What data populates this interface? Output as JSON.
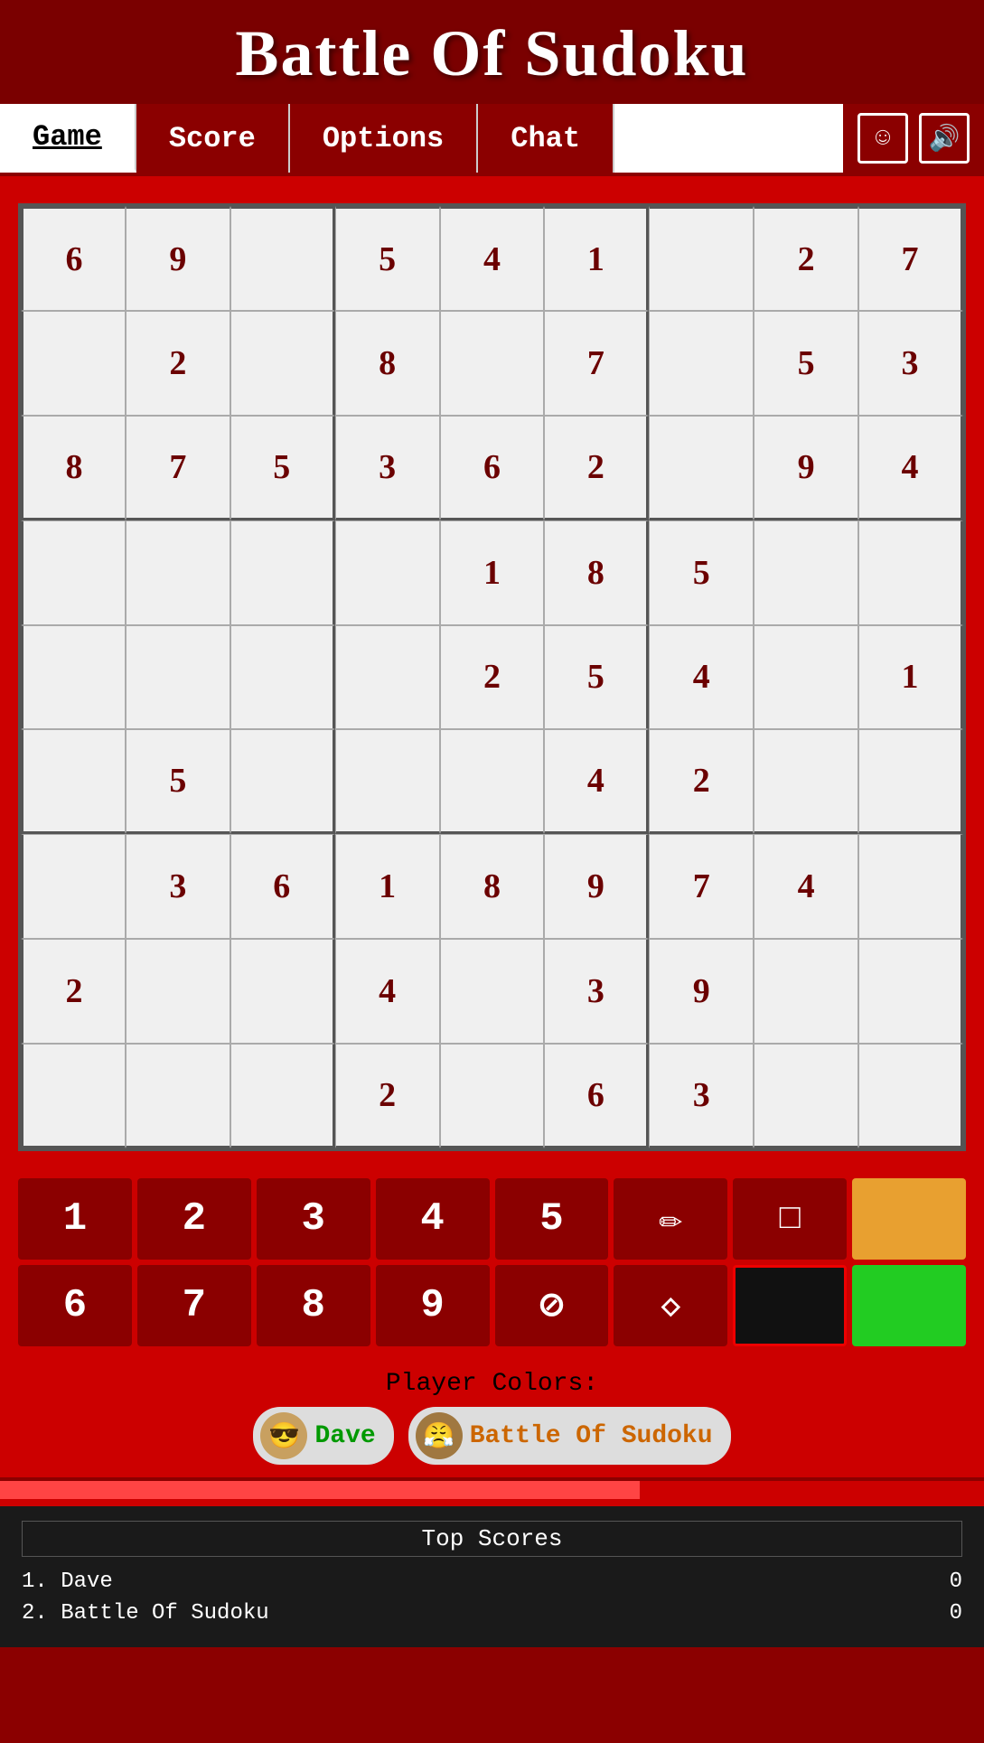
{
  "header": {
    "title": "Battle Of Sudoku"
  },
  "navbar": {
    "tabs": [
      {
        "id": "game",
        "label": "Game",
        "active": true
      },
      {
        "id": "score",
        "label": "Score",
        "active": false
      },
      {
        "id": "options",
        "label": "Options",
        "active": false
      },
      {
        "id": "chat",
        "label": "Chat",
        "active": false
      }
    ],
    "icons": [
      {
        "id": "emoji",
        "symbol": "☺"
      },
      {
        "id": "sound",
        "symbol": "🔊"
      }
    ]
  },
  "grid": {
    "cells": [
      "6",
      "9",
      "",
      "5",
      "4",
      "1",
      "",
      "2",
      "7",
      "",
      "2",
      "",
      "8",
      "",
      "7",
      "",
      "5",
      "3",
      "8",
      "7",
      "5",
      "3",
      "6",
      "2",
      "",
      "9",
      "4",
      "",
      "",
      "",
      "",
      "1",
      "8",
      "5",
      "",
      "",
      "",
      "",
      "",
      "",
      "2",
      "5",
      "4",
      "",
      "1",
      "",
      "5",
      "",
      "",
      "",
      "4",
      "2",
      "",
      "",
      "",
      "3",
      "6",
      "1",
      "8",
      "9",
      "7",
      "4",
      "",
      "2",
      "",
      "",
      "4",
      "",
      "3",
      "9",
      "",
      "",
      "",
      "",
      "",
      "2",
      "",
      "6",
      "3",
      "",
      ""
    ]
  },
  "numpad": {
    "row1": [
      {
        "id": "n1",
        "label": "1",
        "type": "number"
      },
      {
        "id": "n2",
        "label": "2",
        "type": "number"
      },
      {
        "id": "n3",
        "label": "3",
        "type": "number"
      },
      {
        "id": "n4",
        "label": "4",
        "type": "number"
      },
      {
        "id": "n5",
        "label": "5",
        "type": "number"
      },
      {
        "id": "pencil",
        "label": "✏",
        "type": "tool"
      },
      {
        "id": "square",
        "label": "□",
        "type": "tool"
      },
      {
        "id": "orange",
        "label": "",
        "type": "color",
        "color": "#e8a030"
      }
    ],
    "row2": [
      {
        "id": "n6",
        "label": "6",
        "type": "number"
      },
      {
        "id": "n7",
        "label": "7",
        "type": "number"
      },
      {
        "id": "n8",
        "label": "8",
        "type": "number"
      },
      {
        "id": "n9",
        "label": "9",
        "type": "number"
      },
      {
        "id": "no",
        "label": "⊘",
        "type": "tool"
      },
      {
        "id": "fill",
        "label": "◈",
        "type": "tool"
      },
      {
        "id": "black",
        "label": "",
        "type": "color",
        "color": "#111111"
      },
      {
        "id": "green",
        "label": "",
        "type": "color",
        "color": "#22cc22"
      }
    ]
  },
  "playerColors": {
    "label": "Player Colors:",
    "players": [
      {
        "id": "dave",
        "name": "Dave",
        "nameColor": "green",
        "avatar": "😎"
      },
      {
        "id": "bos",
        "name": "Battle Of Sudoku",
        "nameColor": "orange",
        "avatar": "😤"
      }
    ]
  },
  "topScores": {
    "title": "Top Scores",
    "scores": [
      {
        "rank": "1.",
        "name": "Dave",
        "score": "0"
      },
      {
        "rank": "2.",
        "name": "Battle Of Sudoku",
        "score": "0"
      }
    ]
  }
}
